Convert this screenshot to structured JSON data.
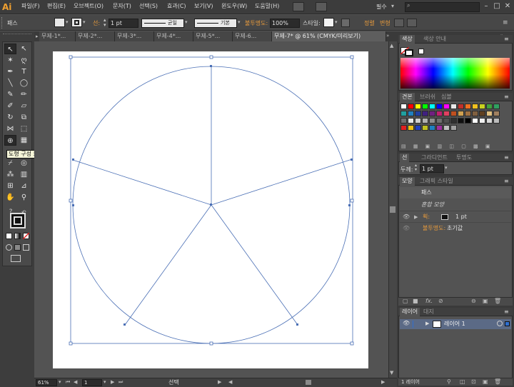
{
  "app": {
    "logo": "Ai",
    "menus": [
      "파일(F)",
      "편집(E)",
      "오브젝트(O)",
      "문자(T)",
      "선택(S)",
      "효과(C)",
      "보기(V)",
      "윈도우(W)",
      "도움말(H)"
    ],
    "workspace": "필수",
    "window_buttons": [
      "–",
      "□",
      "✕"
    ]
  },
  "control_bar": {
    "selection_label": "패스",
    "stroke_label": "선:",
    "stroke_width": "1 pt",
    "profile_label": "균일",
    "brush_label": "기본",
    "opacity_label": "불투명도:",
    "opacity_value": "100%",
    "style_label": "스타일:",
    "align_label": "정렬",
    "transform_label": "변형"
  },
  "tools": {
    "tooltip": "도형 구성 도구 (Shift+M)",
    "stroke_weight": "?"
  },
  "doc_tabs": [
    {
      "label": "무제-1*..."
    },
    {
      "label": "무제-2*..."
    },
    {
      "label": "무제-3*..."
    },
    {
      "label": "무제-4*..."
    },
    {
      "label": "무제-5*..."
    },
    {
      "label": "무제-6..."
    },
    {
      "label": "무제-7* @ 61% (CMYK/미리보기)"
    }
  ],
  "status": {
    "zoom": "61%",
    "page": "1",
    "mode": "선택"
  },
  "color_panel": {
    "tabs": [
      "색상",
      "색상 안내"
    ]
  },
  "swatch_panel": {
    "tabs": [
      "견본",
      "브러쉬",
      "심볼"
    ],
    "rows": [
      [
        "#ffffff",
        "#ff0000",
        "#ffff00",
        "#00ff00",
        "#00ffff",
        "#0000ff",
        "#ff00ff",
        "#e8e8e8",
        "#c0302a",
        "#f07020",
        "#f0c020",
        "#c8d020",
        "#40a040",
        "#30a060"
      ],
      [
        "#20a0a0",
        "#2080c0",
        "#2040a0",
        "#402080",
        "#702080",
        "#c02070",
        "#e04060",
        "#c05020",
        "#d0a050",
        "#a07040",
        "#806040",
        "#604020",
        "#e0c080",
        "#a08060"
      ],
      [
        "#707070",
        "#e8e8e8",
        "#d0d0d0",
        "#b0b0b0",
        "#909090",
        "#707070",
        "#505050",
        "#303030",
        "#101010",
        "#000000",
        "#ffffff",
        "#f0f0f0",
        "#d8d8d8",
        "#bcbcbc"
      ],
      [
        "#e02020",
        "#f0c010",
        "#2040c0",
        "#c0c020",
        "#2080c0",
        "#a030a0",
        "#c0c0c0",
        "#a0a0a0"
      ]
    ]
  },
  "stroke_panel": {
    "tabs": [
      "선",
      "그라디언트",
      "투명도"
    ],
    "weight_label": "두께:",
    "weight_value": "1 pt"
  },
  "appearance_panel": {
    "tabs": [
      "모양",
      "그래픽 스타일"
    ],
    "object": "패스",
    "group": "혼합 모양",
    "stroke_label": "획:",
    "stroke_value": "1 pt",
    "opacity_label": "불투명도:",
    "opacity_value": "초기값",
    "fx": "fx."
  },
  "layers_panel": {
    "tabs": [
      "레이어",
      "대지"
    ],
    "layer_name": "레이어 1",
    "footer": "1 레이어"
  }
}
